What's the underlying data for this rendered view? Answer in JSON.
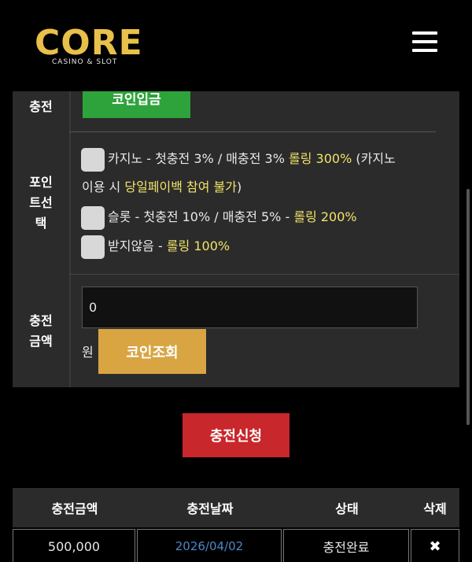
{
  "header": {
    "logo_text": "CORE",
    "logo_sub": "CASINO & SLOT",
    "menu_icon": "hamburger-menu-icon"
  },
  "form": {
    "charge_label": "충전",
    "coin_deposit_button": "코인입금",
    "point_label_lines": [
      "포인",
      "트선",
      "택"
    ],
    "options": [
      {
        "parts": [
          {
            "t": "카지노 - 첫충전 3% / 매충전 3% ",
            "hl": false
          },
          {
            "t": "롤링 300%",
            "hl": true
          },
          {
            "t": " (카지노",
            "hl": false
          }
        ],
        "line2": [
          {
            "t": "이용 시 ",
            "hl": false
          },
          {
            "t": "당일페이백 참여 불가",
            "hl": true
          },
          {
            "t": ")",
            "hl": false
          }
        ],
        "checked": false
      },
      {
        "parts": [
          {
            "t": "슬롯 - 첫충전 10% / 매충전 5% - ",
            "hl": false
          },
          {
            "t": "롤링 200%",
            "hl": true
          }
        ],
        "checked": false
      },
      {
        "parts": [
          {
            "t": "받지않음 - ",
            "hl": false
          },
          {
            "t": "롤링 100%",
            "hl": true
          }
        ],
        "checked": false
      }
    ],
    "amount_label_lines": [
      "충전",
      "금액"
    ],
    "amount_value": "0",
    "currency_unit": "원",
    "coin_check_button": "코인조회",
    "submit_button": "충전신청"
  },
  "history": {
    "headers": [
      "충전금액",
      "충전날짜",
      "상태",
      "삭제"
    ],
    "rows": [
      {
        "amount": "500,000",
        "date": "2026/04/02",
        "status": "충전완료",
        "delete": "✖"
      }
    ]
  },
  "colors": {
    "accent_green": "#2fa33b",
    "accent_gold": "#d8a542",
    "accent_red": "#c8272b",
    "highlight_text": "#f1e36a",
    "date_link": "#4f86c9"
  }
}
